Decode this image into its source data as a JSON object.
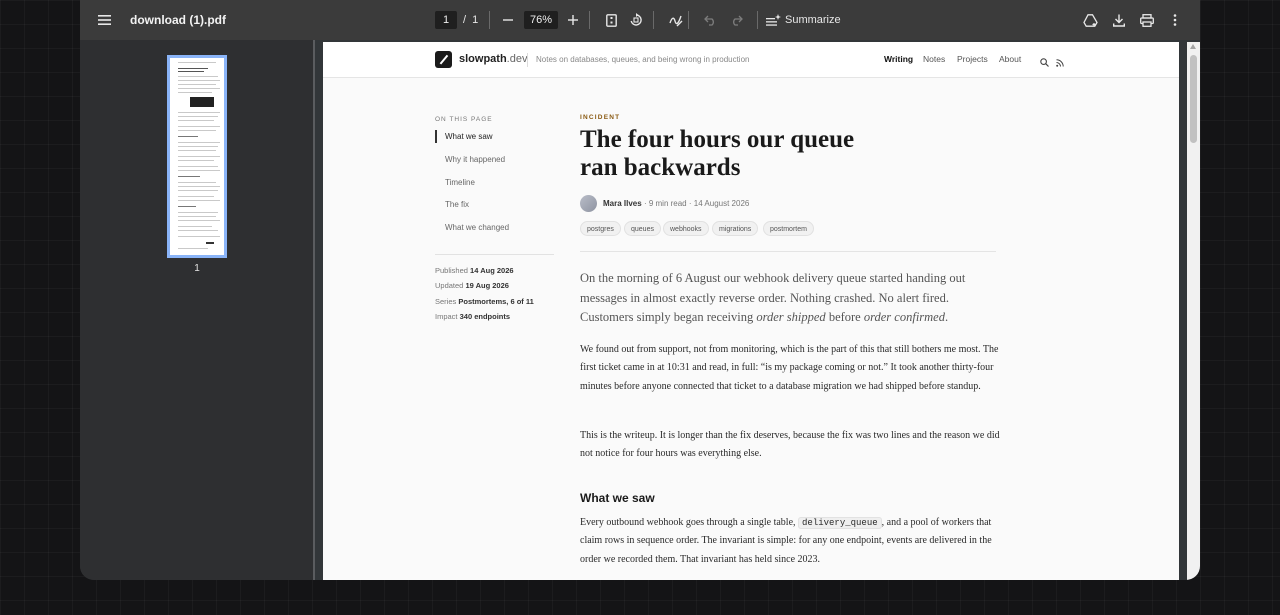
{
  "viewer": {
    "file_name": "download (1).pdf",
    "current_page": "1",
    "page_separator": "/",
    "total_pages": "1",
    "zoom": "76%",
    "summarize_label": "Summarize",
    "thumbnail_page": "1"
  },
  "site": {
    "brand": "slowpath",
    "tld": ".dev",
    "tagline": "Notes on databases, queues, and being wrong in production",
    "nav": [
      "Writing",
      "Notes",
      "Projects",
      "About"
    ]
  },
  "toc": {
    "label": "ON THIS PAGE",
    "items": [
      "What we saw",
      "Why it happened",
      "Timeline",
      "The fix",
      "What we changed"
    ]
  },
  "meta": {
    "published_label": "Published",
    "published": "14 Aug 2026",
    "updated_label": "Updated",
    "updated": "19 Aug 2026",
    "series_label": "Series",
    "series": "Postmortems, 6 of 11",
    "impact_label": "Impact",
    "impact": "340 endpoints"
  },
  "article": {
    "kicker": "INCIDENT",
    "title": "The four hours our queue ran backwards",
    "author": "Mara Ilves",
    "read_time": "· 9 min read ·",
    "date": "14 August 2026",
    "tags": [
      "postgres",
      "queues",
      "webhooks",
      "migrations",
      "postmortem"
    ],
    "lede_1": "On the morning of 6 August our webhook delivery queue started handing out messages in almost exactly reverse order. Nothing crashed. No alert fired. Customers simply began receiving ",
    "lede_em1": "order shipped",
    "lede_2": " before ",
    "lede_em2": "order confirmed",
    "lede_3": ".",
    "p1": "We found out from support, not from monitoring, which is the part of this that still bothers me most. The first ticket came in at 10:31 and read, in full: “is my package coming or not.” It took another thirty-four minutes before anyone connected that ticket to a database migration we had shipped before standup.",
    "p2": "This is the writeup. It is longer than the fix deserves, because the fix was two lines and the reason we did not notice for four hours was everything else.",
    "h2": "What we saw",
    "p3_a": "Every outbound webhook goes through a single table, ",
    "p3_code": "delivery_queue",
    "p3_b": ", and a pool of workers that claim rows in sequence order. The invariant is simple: for any one endpoint, events are delivered in the order we recorded them. That invariant has held since 2023."
  },
  "colors": {
    "toolbar": "#3b3b3b",
    "thumbnail_border": "#8ab4f8",
    "kicker": "#8a5a12"
  },
  "icons": [
    "menu-icon",
    "fit-page-icon",
    "rotate-icon",
    "draw-icon",
    "undo-icon",
    "redo-icon",
    "summarize-icon",
    "drive-icon",
    "download-icon",
    "print-icon",
    "more-icon",
    "search-icon",
    "rss-icon"
  ]
}
